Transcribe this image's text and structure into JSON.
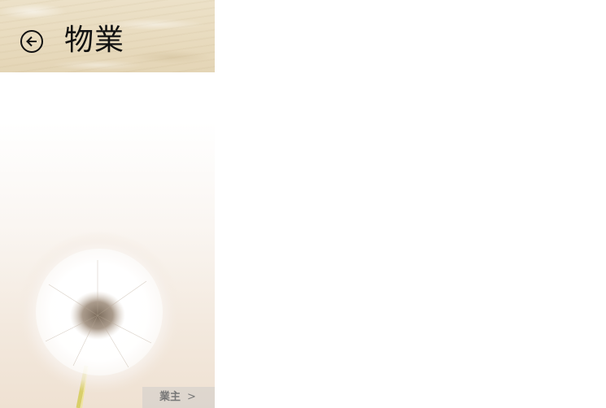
{
  "header": {
    "title": "物業",
    "back_icon": "arrow-left-circle-icon"
  },
  "footer": {
    "next_label": "業主",
    "next_chevron": ">"
  },
  "colors": {
    "header_bg": "#e9dcc0",
    "title_text": "#111111",
    "next_bg": "#c8c8c8",
    "next_text": "#777777"
  }
}
